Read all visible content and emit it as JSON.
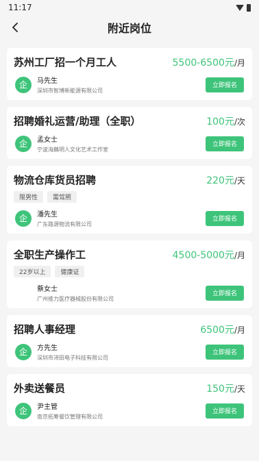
{
  "status_bar": {
    "time": "11:17"
  },
  "header": {
    "title": "附近岗位"
  },
  "jobs": [
    {
      "title": "苏州工厂招一个月工人",
      "salary": "5500-6500元",
      "unit": "/月",
      "tags": [],
      "contact": "马先生",
      "company": "深圳市智博新能源有限公司",
      "logo": "企",
      "apply": "立即报名"
    },
    {
      "title": "招聘婚礼运营/助理（全职）",
      "salary": "100元",
      "unit": "/次",
      "tags": [],
      "contact": "孟女士",
      "company": "宁波海藕明人文化艺术工作室",
      "logo": "企",
      "apply": "立即报名"
    },
    {
      "title": "物流仓库货员招聘",
      "salary": "220元",
      "unit": "/天",
      "tags": [
        "限男性",
        "需驾照"
      ],
      "contact": "潘先生",
      "company": "广东路源物流有限公司",
      "logo": "企",
      "apply": "立即报名"
    },
    {
      "title": "全职生产操作工",
      "salary": "4500-5000元",
      "unit": "/月",
      "tags": [
        "22岁以上",
        "健康证"
      ],
      "contact": "蔡女士",
      "company": "广州维力医疗器械股份有限公司",
      "logo": "",
      "apply": "立即报名"
    },
    {
      "title": "招聘人事经理",
      "salary": "6500元",
      "unit": "/月",
      "tags": [],
      "contact": "方先生",
      "company": "深圳市沛田电子科技有限公司",
      "logo": "企",
      "apply": "立即报名"
    },
    {
      "title": "外卖送餐员",
      "salary": "150元",
      "unit": "/天",
      "tags": [],
      "contact": "尹主管",
      "company": "南京拓筹餐饮管理有限公司",
      "logo": "企",
      "apply": "立即报名"
    }
  ]
}
